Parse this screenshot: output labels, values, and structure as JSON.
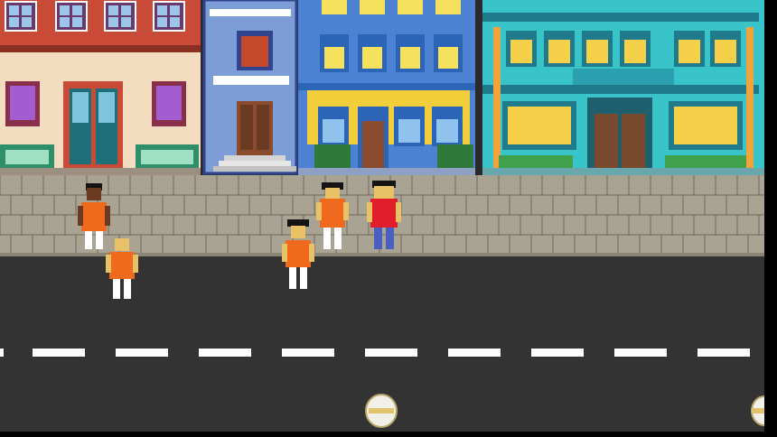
{
  "scene": {
    "type": "pixel-art street game",
    "colors": {
      "sky": "#0e0e0e",
      "sidewalk": "#a9a394",
      "sidewalk_line": "#6f6a5e",
      "road": "#333333",
      "lane_marking": "#ffffff",
      "orange_shirt": "#f06a1e",
      "red_shirt": "#e01e2a",
      "blue_pants": "#4a5fc0",
      "skin": "#e9c268",
      "hair_black": "#141414"
    }
  },
  "buildings": [
    {
      "name": "brick-shop",
      "wall": "#f3dcc0",
      "trim": "#c94a36",
      "accent": "#2f8f6a"
    },
    {
      "name": "blue-townhouse",
      "wall": "#7d9dd6",
      "trim": "#31458f",
      "accent": "#8a4b2e"
    },
    {
      "name": "blue-yellow-rowhouse",
      "wall": "#4d82d2",
      "trim": "#f2cf3a",
      "accent": "#2c64b8"
    },
    {
      "name": "teal-victorian",
      "wall": "#39c4c9",
      "trim": "#f3a23c",
      "accent": "#1f7b8b"
    }
  ],
  "characters": [
    {
      "name": "pedestrian-orange-dark-skin",
      "shirt": "#f06a1e",
      "pants": "#ffffff",
      "hair": "#141414",
      "skin": "#6b3a22"
    },
    {
      "name": "pedestrian-orange-bald",
      "shirt": "#f06a1e",
      "pants": "#ffffff",
      "hair": "none",
      "skin": "#e9c268"
    },
    {
      "name": "pedestrian-orange-black-hair-center",
      "shirt": "#f06a1e",
      "pants": "#ffffff",
      "hair": "#141414",
      "skin": "#e9c268"
    },
    {
      "name": "pedestrian-orange-black-hair-right",
      "shirt": "#f06a1e",
      "pants": "#ffffff",
      "hair": "#141414",
      "skin": "#e9c268"
    },
    {
      "name": "player-red-shirt",
      "shirt": "#e01e2a",
      "pants": "#4a5fc0",
      "hair": "#141414",
      "skin": "#e9c268"
    }
  ],
  "items": [
    {
      "name": "helmet-item-center"
    },
    {
      "name": "helmet-item-right-edge"
    }
  ]
}
